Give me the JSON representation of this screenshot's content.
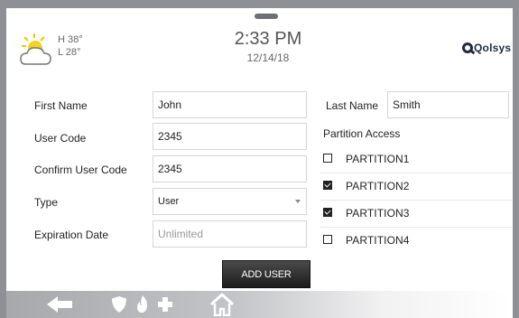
{
  "weather": {
    "high": "H 38°",
    "low": "L 28°",
    "icon": "partly-cloudy-icon"
  },
  "clock": {
    "time": "2:33 PM",
    "date": "12/14/18"
  },
  "brand": {
    "logo_text": "Qolsys"
  },
  "form": {
    "first_name": {
      "label": "First Name",
      "value": "John"
    },
    "last_name": {
      "label": "Last Name",
      "value": "Smith"
    },
    "user_code": {
      "label": "User Code",
      "value": "2345"
    },
    "confirm_user_code": {
      "label": "Confirm User Code",
      "value": "2345"
    },
    "type": {
      "label": "Type",
      "value": "User"
    },
    "expiration_date": {
      "label": "Expiration Date",
      "placeholder": "Unlimited"
    }
  },
  "partitions": {
    "title": "Partition Access",
    "items": [
      {
        "label": "PARTITION1",
        "checked": false
      },
      {
        "label": "PARTITION2",
        "checked": true
      },
      {
        "label": "PARTITION3",
        "checked": true
      },
      {
        "label": "PARTITION4",
        "checked": false
      }
    ]
  },
  "actions": {
    "add_user": "ADD USER"
  },
  "navbar": {
    "icons": [
      "back-arrow-icon",
      "shield-icon",
      "fire-icon",
      "medical-cross-icon",
      "home-icon"
    ]
  }
}
